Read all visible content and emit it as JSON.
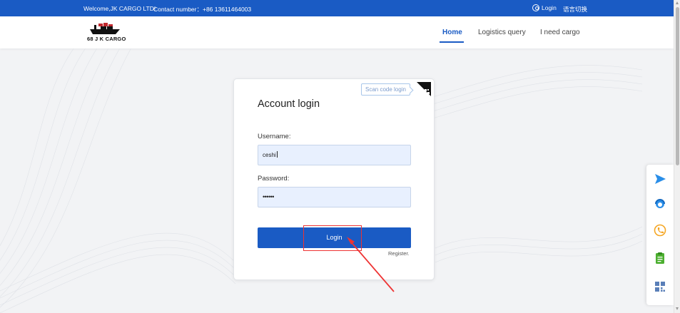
{
  "topbar": {
    "welcome": "Welcome,JK CARGO LTD!",
    "contact": "Contact number：+86 13611464003",
    "login": "Login",
    "language": "语言切换"
  },
  "header": {
    "logo_text": "68 J K CARGO",
    "nav": [
      {
        "label": "Home",
        "active": true
      },
      {
        "label": "Logistics query",
        "active": false
      },
      {
        "label": "I need cargo",
        "active": false
      }
    ]
  },
  "login_card": {
    "scan_tip": "Scan code login",
    "title": "Account login",
    "username_label": "Username:",
    "username_value": "ceshi",
    "password_label": "Password:",
    "password_value": "••••••",
    "login_button": "Login",
    "register_link": "Register."
  },
  "side_panel": {
    "icons": [
      "send-icon",
      "customer-service-icon",
      "phone-icon",
      "clipboard-icon",
      "qr-code-icon"
    ]
  },
  "colors": {
    "primary": "#1a5bc4",
    "annotation": "#e33333"
  }
}
